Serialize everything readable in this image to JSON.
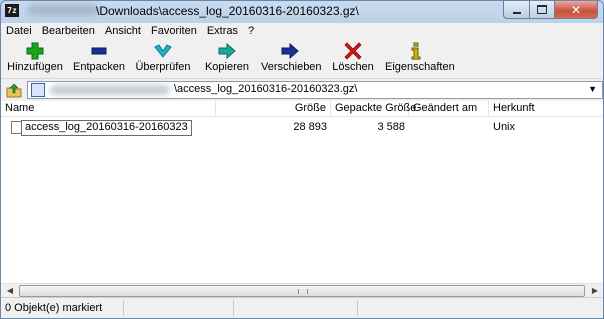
{
  "window": {
    "title_suffix": "\\Downloads\\access_log_20160316-20160323.gz\\",
    "app_icon_text": "7z",
    "close_glyph": "✕"
  },
  "menu": [
    "Datei",
    "Bearbeiten",
    "Ansicht",
    "Favoriten",
    "Extras",
    "?"
  ],
  "toolbar": [
    {
      "label": "Hinzufügen",
      "icon": "plus-icon",
      "color": "#1aa51a"
    },
    {
      "label": "Entpacken",
      "icon": "minus-icon",
      "color": "#1a2f9a"
    },
    {
      "label": "Überprüfen",
      "icon": "check-icon",
      "color": "#1eb4c8"
    },
    {
      "label": "Kopieren",
      "icon": "copy-arrow-icon",
      "color": "#1aa89a"
    },
    {
      "label": "Verschieben",
      "icon": "move-arrow-icon",
      "color": "#1a2f9a"
    },
    {
      "label": "Löschen",
      "icon": "delete-x-icon",
      "color": "#d01818"
    },
    {
      "label": "Eigenschaften",
      "icon": "info-icon",
      "color": "#d4b400"
    }
  ],
  "address": {
    "path_suffix": "\\access_log_20160316-20160323.gz\\",
    "dropdown_glyph": "▼"
  },
  "columns": [
    "Name",
    "Größe",
    "Gepackte Größe",
    "Geändert am",
    "Herkunft"
  ],
  "files": [
    {
      "name": "access_log_20160316-20160323",
      "size": "28 893",
      "packed": "3 588",
      "modified": "",
      "origin": "Unix"
    }
  ],
  "status": {
    "text": "0 Objekt(e) markiert"
  }
}
